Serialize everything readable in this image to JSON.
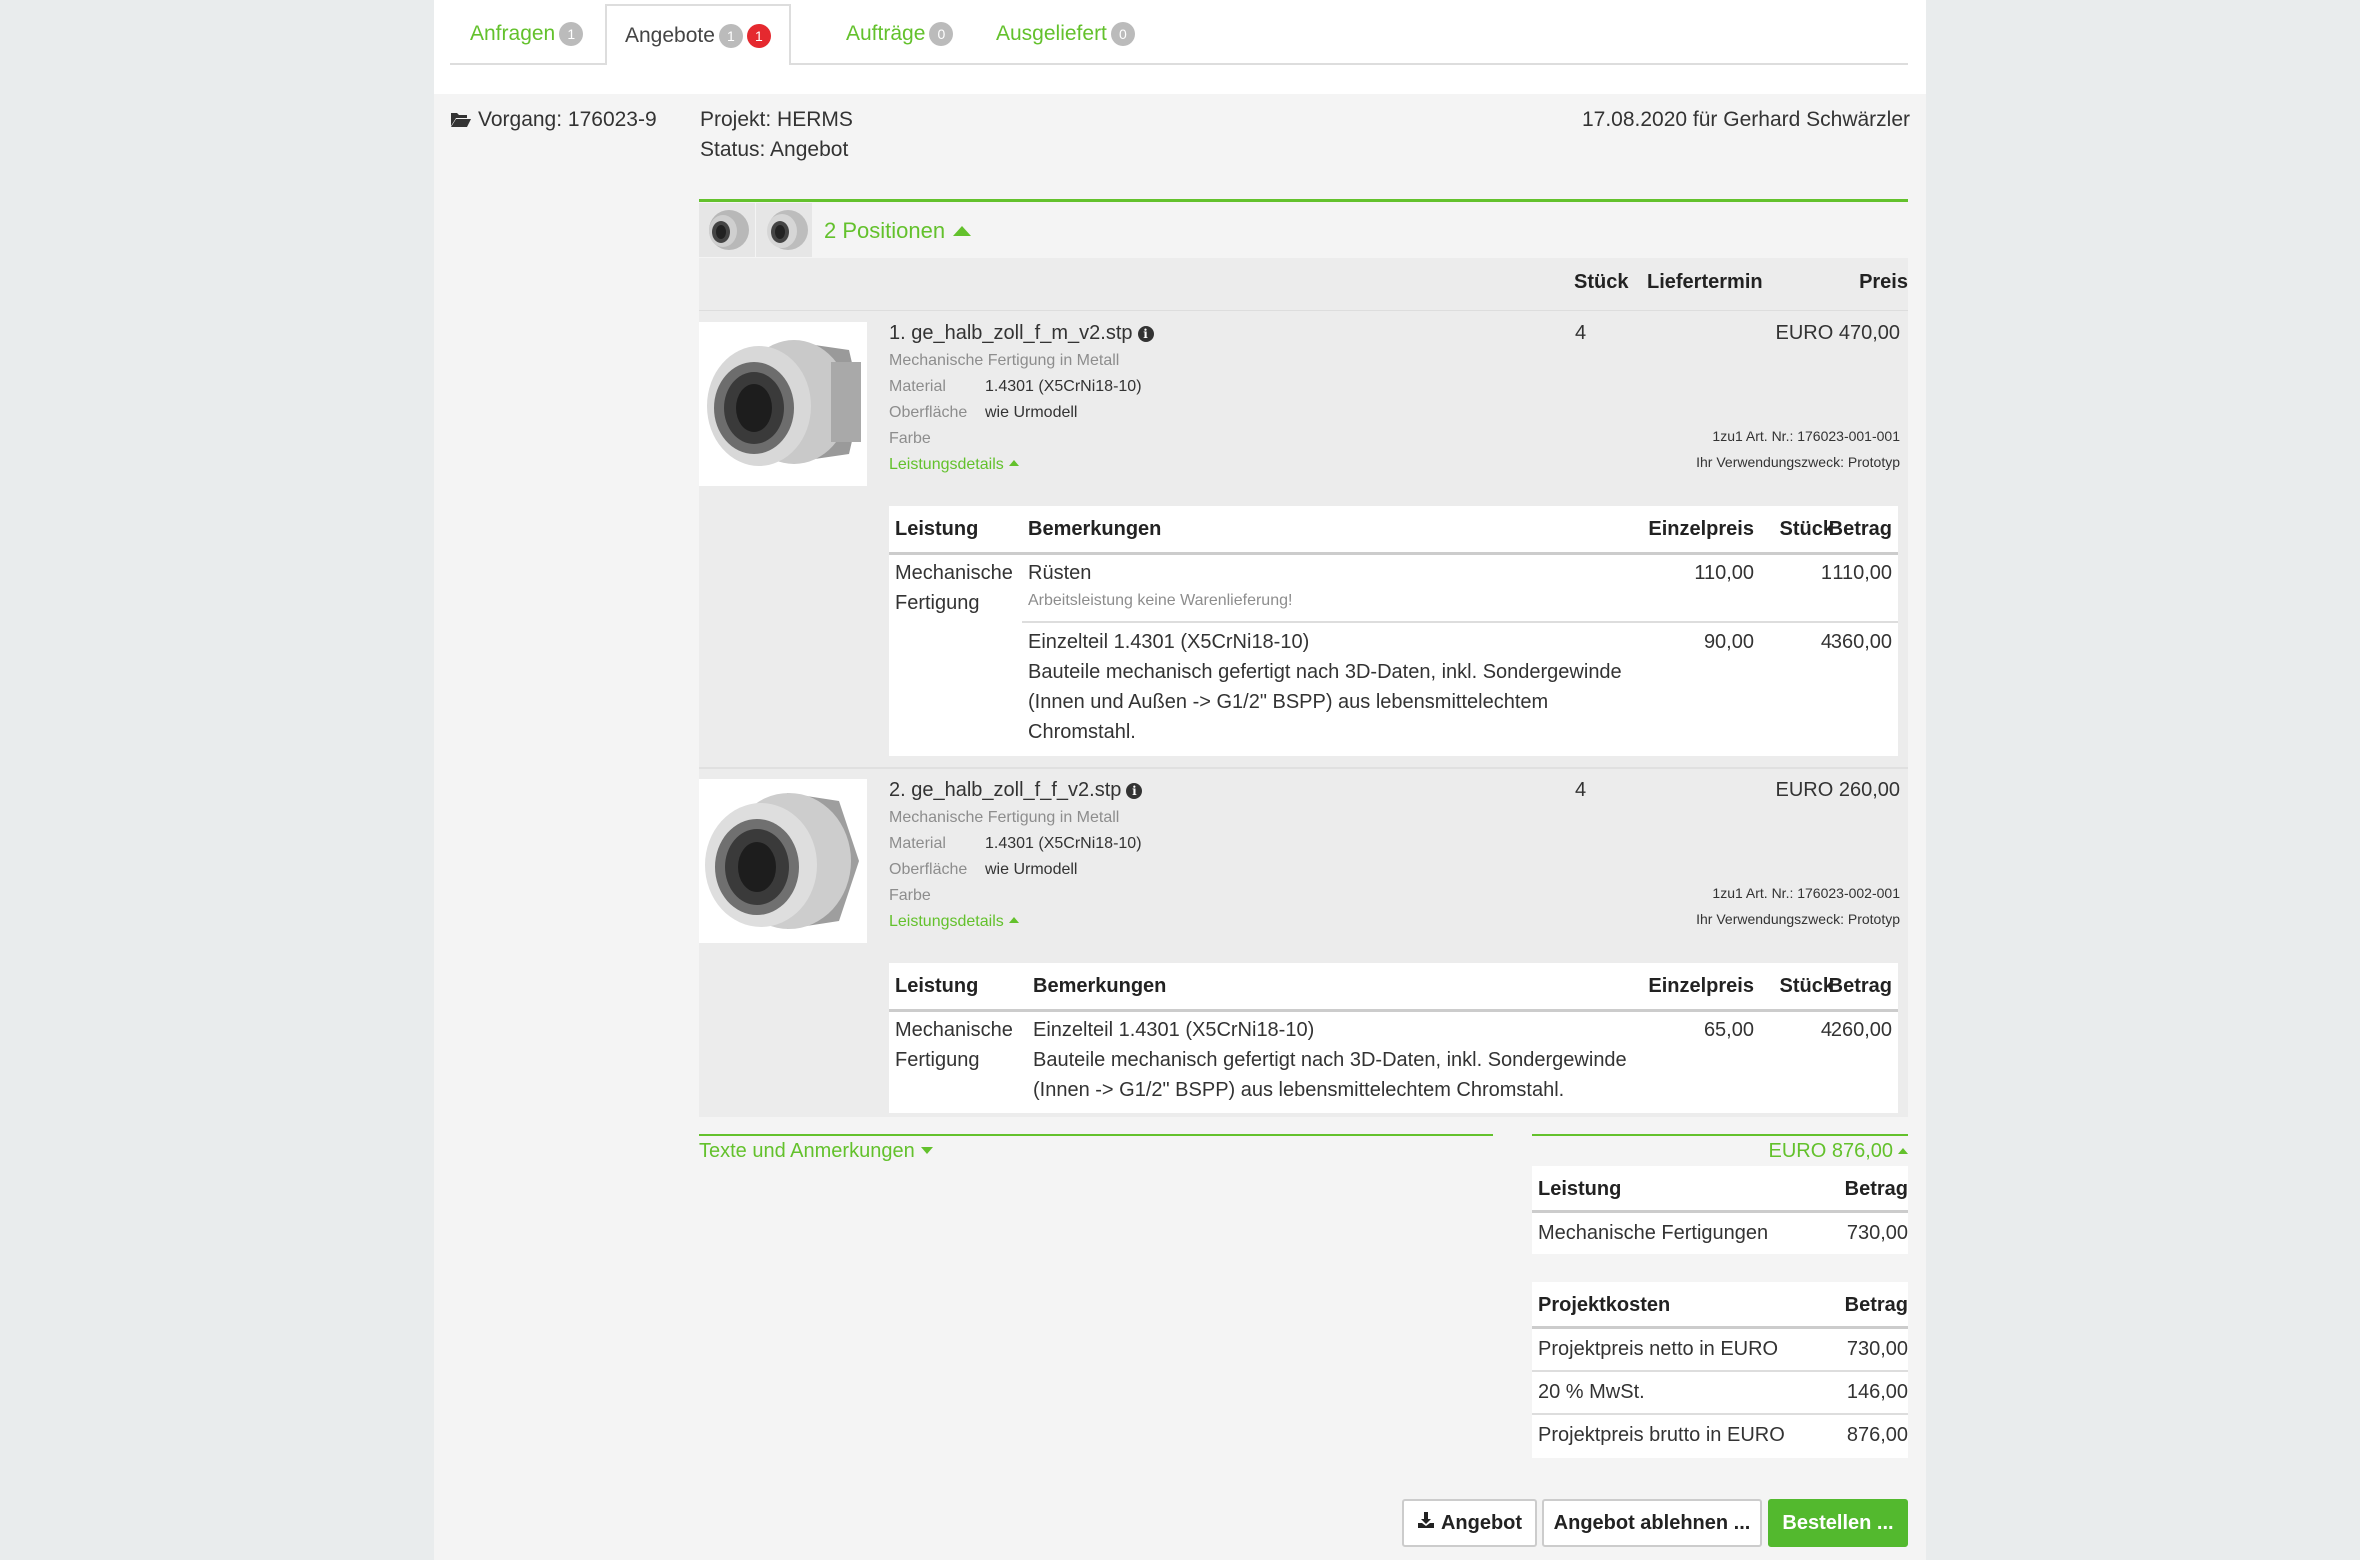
{
  "tabs": [
    {
      "label": "Anfragen",
      "badge": "1"
    },
    {
      "label": "Angebote",
      "badge": "1",
      "badge2": "1"
    },
    {
      "label": "Aufträge",
      "badge": "0"
    },
    {
      "label": "Ausgeliefert",
      "badge": "0"
    }
  ],
  "header": {
    "vorgang": "Vorgang: 176023-9",
    "projekt": "Projekt: HERMS",
    "status": "Status: Angebot",
    "date_for": "17.08.2020 für Gerhard Schwärzler"
  },
  "positions": {
    "toggle": "2 Positionen",
    "col_qty": "Stück",
    "col_date": "Liefertermin",
    "col_price": "Preis"
  },
  "items": [
    {
      "name": "1. ge_halb_zoll_f_m_v2.stp",
      "process": "Mechanische Fertigung in Metall",
      "material_label": "Material",
      "material": "1.4301 (X5CrNi18-10)",
      "surface_label": "Oberfläche",
      "surface": "wie Urmodell",
      "color_label": "Farbe",
      "details_toggle": "Leistungsdetails",
      "qty": "4",
      "price": "EURO 470,00",
      "art_nr": "1zu1 Art. Nr.: 176023-001-001",
      "purpose": "Ihr Verwendungszweck: Prototyp",
      "table": {
        "headers": [
          "Leistung",
          "Bemerkungen",
          "Einzelpreis",
          "Stück",
          "Betrag"
        ],
        "service": [
          "Mechanische",
          "Fertigung"
        ],
        "rows": [
          {
            "title": "Rüsten",
            "note": "Arbeitsleistung keine Warenlieferung!",
            "unit_price": "110,00",
            "qty": "1",
            "amount": "110,00"
          },
          {
            "title": "Einzelteil 1.4301 (X5CrNi18-10)",
            "lines": [
              "Bauteile mechanisch gefertigt nach 3D-Daten, inkl. Sondergewinde",
              "(Innen und Außen -> G1/2\" BSPP) aus lebensmittelechtem",
              "Chromstahl."
            ],
            "unit_price": "90,00",
            "qty": "4",
            "amount": "360,00"
          }
        ]
      }
    },
    {
      "name": "2. ge_halb_zoll_f_f_v2.stp",
      "process": "Mechanische Fertigung in Metall",
      "material_label": "Material",
      "material": "1.4301 (X5CrNi18-10)",
      "surface_label": "Oberfläche",
      "surface": "wie Urmodell",
      "color_label": "Farbe",
      "details_toggle": "Leistungsdetails",
      "qty": "4",
      "price": "EURO 260,00",
      "art_nr": "1zu1 Art. Nr.: 176023-002-001",
      "purpose": "Ihr Verwendungszweck: Prototyp",
      "table": {
        "headers": [
          "Leistung",
          "Bemerkungen",
          "Einzelpreis",
          "Stück",
          "Betrag"
        ],
        "service": [
          "Mechanische",
          "Fertigung"
        ],
        "rows": [
          {
            "title": "Einzelteil 1.4301 (X5CrNi18-10)",
            "lines": [
              "Bauteile mechanisch gefertigt nach 3D-Daten, inkl. Sondergewinde",
              "(Innen -> G1/2\" BSPP) aus lebensmittelechtem Chromstahl."
            ],
            "unit_price": "65,00",
            "qty": "4",
            "amount": "260,00"
          }
        ]
      }
    }
  ],
  "texts_toggle": "Texte und Anmerkungen",
  "summary": {
    "total": "EURO 876,00",
    "table1": {
      "col1": "Leistung",
      "col2": "Betrag",
      "rows": [
        {
          "label": "Mechanische Fertigungen",
          "value": "730,00"
        }
      ]
    },
    "table2": {
      "col1": "Projektkosten",
      "col2": "Betrag",
      "rows": [
        {
          "label": "Projektpreis netto in EURO",
          "value": "730,00"
        },
        {
          "label": "20 % MwSt.",
          "value": "146,00"
        },
        {
          "label": "Projektpreis brutto in EURO",
          "value": "876,00"
        }
      ]
    }
  },
  "buttons": {
    "download": "Angebot",
    "reject": "Angebot ablehnen ...",
    "order": "Bestellen ..."
  },
  "icons": [
    "folder-open-icon",
    "info-icon",
    "caret-up-icon",
    "caret-down-icon",
    "download-icon"
  ],
  "colors": {
    "accent": "#63c12c",
    "button_primary": "#53b92e",
    "badge_red": "#e5292f"
  }
}
